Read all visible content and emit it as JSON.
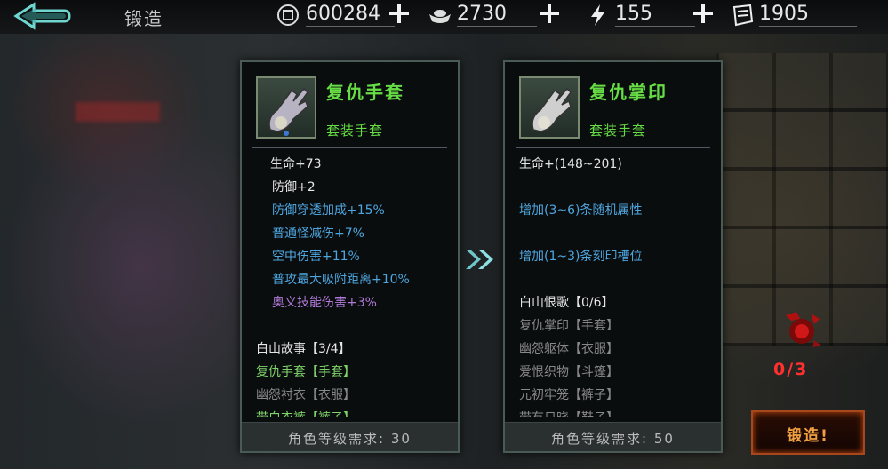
{
  "header": {
    "title": "锻造",
    "resources": [
      {
        "icon": "coin-icon",
        "value": "600284"
      },
      {
        "icon": "silver-ingot-icon",
        "value": "2730"
      },
      {
        "icon": "lightning-icon",
        "value": "155"
      },
      {
        "icon": "ticket-icon",
        "value": "1905"
      }
    ]
  },
  "left_item": {
    "name": "复仇手套",
    "type": "套装手套",
    "stats": [
      {
        "text": "生命+73",
        "color": "white"
      },
      {
        "text": "防御+2",
        "color": "white"
      },
      {
        "text": "防御穿透加成+15%",
        "color": "blue"
      },
      {
        "text": "普通怪减伤+7%",
        "color": "blue"
      },
      {
        "text": "空中伤害+11%",
        "color": "blue"
      },
      {
        "text": "普攻最大吸附距离+10%",
        "color": "blue"
      },
      {
        "text": "奥义技能伤害+3%",
        "color": "purple"
      }
    ],
    "set_title": "白山故事【3/4】",
    "set_items": [
      {
        "text": "复仇手套【手套】",
        "color": "green"
      },
      {
        "text": "幽怨衬衣【衣服】",
        "color": "grey"
      },
      {
        "text": "带白衣裤【裤子】",
        "color": "green"
      }
    ],
    "requirement": "角色等级需求: 30"
  },
  "right_item": {
    "name": "复仇掌印",
    "type": "套装手套",
    "stats": [
      {
        "text": "生命+(148~201)",
        "color": "white"
      },
      {
        "text": "增加(3~6)条随机属性",
        "color": "blue"
      },
      {
        "text": "增加(1~3)条刻印槽位",
        "color": "blue"
      }
    ],
    "set_title": "白山恨歌【0/6】",
    "set_items": [
      {
        "text": "复仇掌印【手套】",
        "color": "grey"
      },
      {
        "text": "幽怨躯体【衣服】",
        "color": "grey"
      },
      {
        "text": "爱恨织物【斗篷】",
        "color": "grey"
      },
      {
        "text": "元初牢笼【裤子】",
        "color": "grey"
      },
      {
        "text": "带有日晓【鞋子】",
        "color": "grey"
      }
    ],
    "requirement": "角色等级需求: 50"
  },
  "forge": {
    "material_count": "0/3",
    "button_label": "锻造!"
  }
}
